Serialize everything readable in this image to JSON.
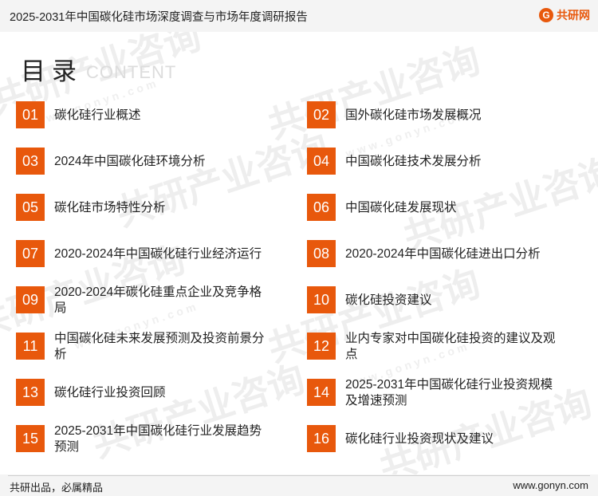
{
  "header": {
    "title": "2025-2031年中国碳化硅市场深度调查与市场年度调研报告",
    "logo_text": "共研网",
    "logo_mark": "G"
  },
  "heading": {
    "main": "目录",
    "english": "CONTENT"
  },
  "watermark": {
    "brand": "共研产业咨询",
    "site": "www.gonyn.com"
  },
  "toc": [
    {
      "num": "01",
      "label": "碳化硅行业概述"
    },
    {
      "num": "02",
      "label": "国外碳化硅市场发展概况"
    },
    {
      "num": "03",
      "label": "2024年中国碳化硅环境分析"
    },
    {
      "num": "04",
      "label": "中国碳化硅技术发展分析"
    },
    {
      "num": "05",
      "label": "碳化硅市场特性分析"
    },
    {
      "num": "06",
      "label": "中国碳化硅发展现状"
    },
    {
      "num": "07",
      "label": "2020-2024年中国碳化硅行业经济运行"
    },
    {
      "num": "08",
      "label": "2020-2024年中国碳化硅进出口分析"
    },
    {
      "num": "09",
      "label": "2020-2024年碳化硅重点企业及竞争格局"
    },
    {
      "num": "10",
      "label": "碳化硅投资建议"
    },
    {
      "num": "11",
      "label": "中国碳化硅未来发展预测及投资前景分析"
    },
    {
      "num": "12",
      "label": "业内专家对中国碳化硅投资的建议及观点"
    },
    {
      "num": "13",
      "label": "碳化硅行业投资回顾"
    },
    {
      "num": "14",
      "label": "2025-2031年中国碳化硅行业投资规模及增速预测"
    },
    {
      "num": "15",
      "label": "2025-2031年中国碳化硅行业发展趋势预测"
    },
    {
      "num": "16",
      "label": "碳化硅行业投资现状及建议"
    }
  ],
  "footer": {
    "left": "共研出品，必属精品",
    "right": "www.gonyn.com"
  },
  "colors": {
    "accent": "#e8580c",
    "bar": "#f4f4f4"
  }
}
